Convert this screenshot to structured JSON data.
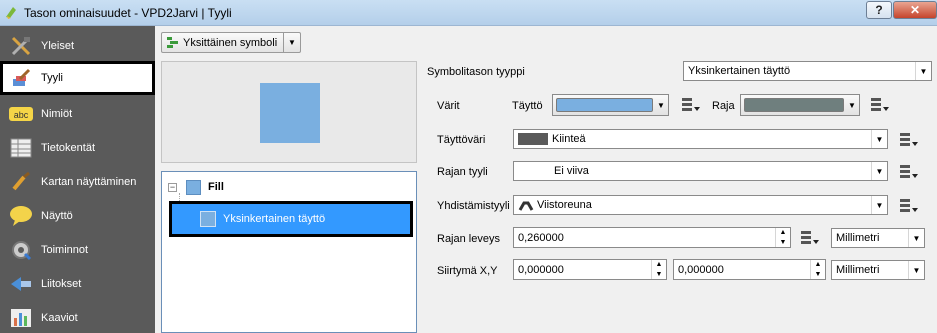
{
  "window": {
    "title": "Tason ominaisuudet - VPD2Jarvi | Tyyli",
    "help_label": "?",
    "close_label": "✕"
  },
  "sidebar": {
    "items": [
      {
        "label": "Yleiset",
        "icon": "tools-icon"
      },
      {
        "label": "Tyyli",
        "icon": "paintbrush-icon",
        "selected": true
      },
      {
        "label": "Nimiöt",
        "icon": "abc-label-icon"
      },
      {
        "label": "Tietokentät",
        "icon": "table-icon"
      },
      {
        "label": "Kartan näyttäminen",
        "icon": "brush-icon"
      },
      {
        "label": "Näyttö",
        "icon": "speech-bubble-icon"
      },
      {
        "label": "Toiminnot",
        "icon": "gear-icon"
      },
      {
        "label": "Liitokset",
        "icon": "join-icon"
      },
      {
        "label": "Kaaviot",
        "icon": "chart-icon"
      }
    ]
  },
  "renderer": {
    "label": "Yksittäinen symboli"
  },
  "tree": {
    "expander": "−",
    "root_label": "Fill",
    "layer_label": "Yksinkertainen täyttö"
  },
  "props": {
    "layer_type_label": "Symbolitason tyyppi",
    "layer_type_value": "Yksinkertainen täyttö",
    "colors_label": "Värit",
    "fill_label": "Täyttö",
    "border_label": "Raja",
    "fill_color": "#7aafe0",
    "border_color": "#6f7f7e",
    "fill_style_label": "Täyttöväri",
    "fill_style_value": "Kiinteä",
    "border_style_label": "Rajan tyyli",
    "border_style_value": "Ei viiva",
    "join_style_label": "Yhdistämistyyli",
    "join_style_value": "Viistoreuna",
    "border_width_label": "Rajan leveys",
    "border_width_value": "0,260000",
    "border_width_unit": "Millimetri",
    "offset_label": "Siirtymä X,Y",
    "offset_x": "0,000000",
    "offset_y": "0,000000",
    "offset_unit": "Millimetri"
  }
}
